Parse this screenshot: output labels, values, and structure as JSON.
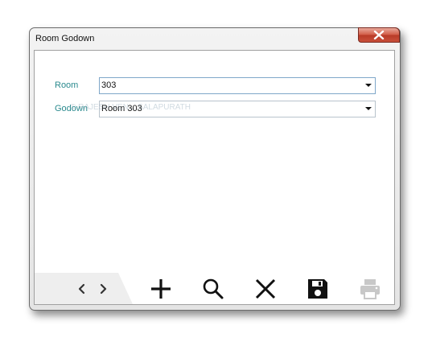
{
  "window": {
    "title": "Room Godown"
  },
  "form": {
    "room": {
      "label": "Room",
      "value": "303"
    },
    "godown": {
      "label": "Godown",
      "value": "Room 303"
    }
  },
  "watermark": "© RAJESH VEN... SALAPURATH",
  "toolbar": {
    "buttons": [
      {
        "name": "prev",
        "icon": "chevron-left-icon"
      },
      {
        "name": "next",
        "icon": "chevron-right-icon"
      },
      {
        "name": "add",
        "icon": "plus-icon"
      },
      {
        "name": "search",
        "icon": "magnifier-icon"
      },
      {
        "name": "delete",
        "icon": "close-x-icon"
      },
      {
        "name": "save",
        "icon": "floppy-disk-icon"
      },
      {
        "name": "print",
        "icon": "printer-icon",
        "state": "disabled"
      }
    ]
  },
  "colors": {
    "label_accent": "#2b8a8e",
    "close_button": "#c9503b",
    "disabled_icon": "#c8c8c8"
  }
}
